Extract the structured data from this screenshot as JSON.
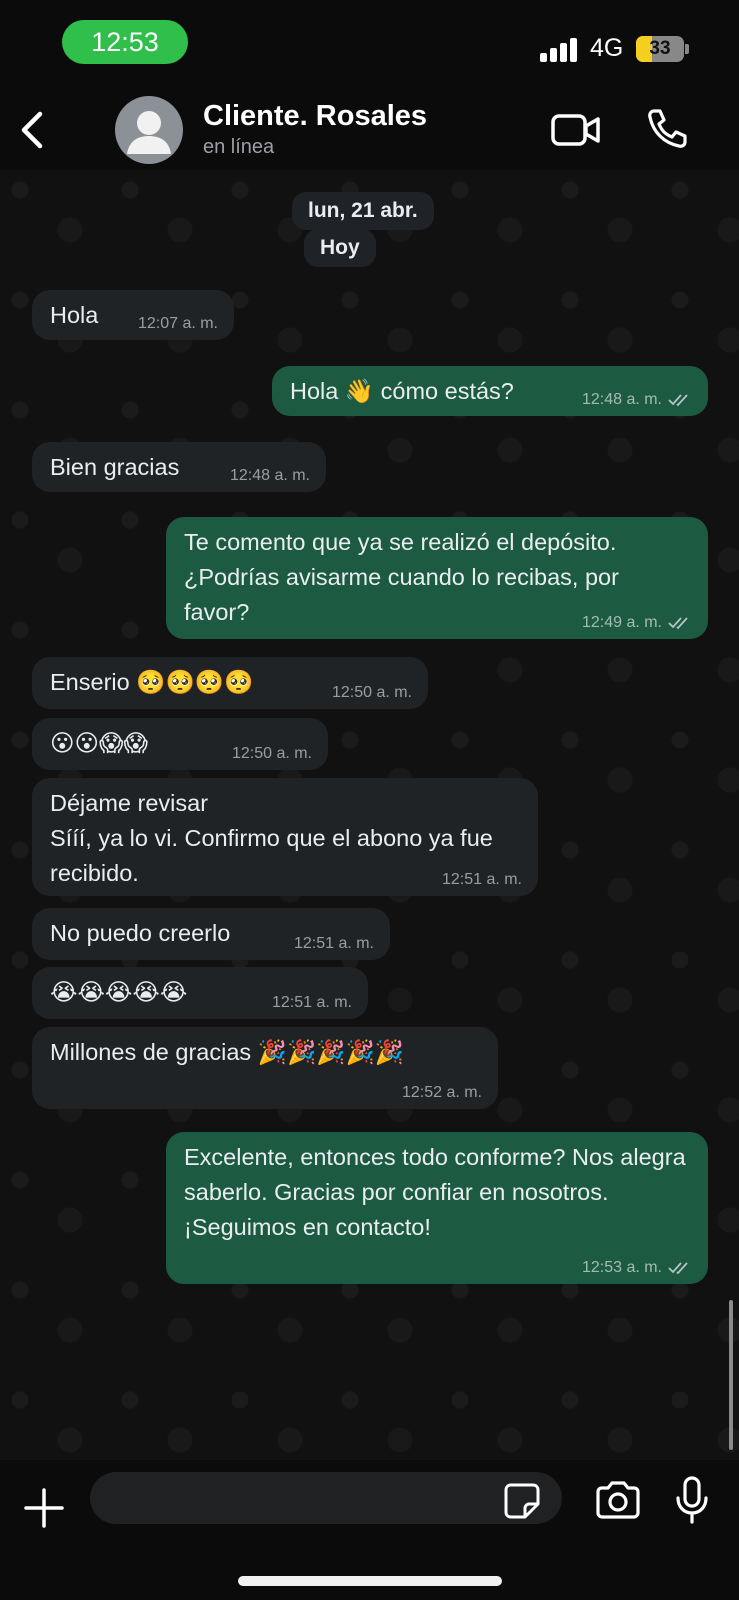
{
  "status_bar": {
    "time": "12:53",
    "network": "4G",
    "battery": "33",
    "battery_fraction": 0.33
  },
  "header": {
    "contact_name": "Cliente. Rosales",
    "contact_status": "en línea"
  },
  "chat": {
    "date_label": "lun, 21 abr.",
    "day_label": "Hoy",
    "messages": [
      {
        "dir": "in",
        "text": "Hola",
        "time": "12:07 a. m."
      },
      {
        "dir": "out",
        "text": "Hola 👋 cómo estás?",
        "time": "12:48 a. m."
      },
      {
        "dir": "in",
        "text": "Bien gracias",
        "time": "12:48 a. m."
      },
      {
        "dir": "out",
        "text": "Te comento que ya se realizó el depósito.\n¿Podrías avisarme cuando lo recibas, por favor?",
        "time": "12:49 a. m."
      },
      {
        "dir": "in",
        "text": "Enserio 🥺🥺🥺🥺",
        "time": "12:50 a. m."
      },
      {
        "dir": "in",
        "text": "😮😮😱😱",
        "time": "12:50 a. m."
      },
      {
        "dir": "in",
        "text": "Déjame revisar\nSííí, ya lo vi. Confirmo que el abono ya fue recibido.",
        "time": "12:51 a. m."
      },
      {
        "dir": "in",
        "text": "No puedo creerlo",
        "time": "12:51 a. m."
      },
      {
        "dir": "in",
        "text": "😭😭😭😭😭",
        "time": "12:51 a. m."
      },
      {
        "dir": "in",
        "text": "Millones de gracias 🎉🎉🎉🎉🎉",
        "time": "12:52 a. m."
      },
      {
        "dir": "out",
        "text": "Excelente, entonces todo conforme? Nos alegra saberlo. Gracias por confiar en nosotros. ¡Seguimos en contacto!",
        "time": "12:53 a. m."
      }
    ]
  },
  "icons": [
    "back-icon",
    "avatar-icon",
    "video-call-icon",
    "phone-icon",
    "plus-icon",
    "sticker-icon",
    "camera-icon",
    "microphone-icon",
    "double-check-icon"
  ],
  "colors": {
    "incoming_bubble": "#202326",
    "outgoing_bubble": "#1c5b42",
    "status_pill": "#2fbf4a",
    "battery": "#f5cf20"
  }
}
